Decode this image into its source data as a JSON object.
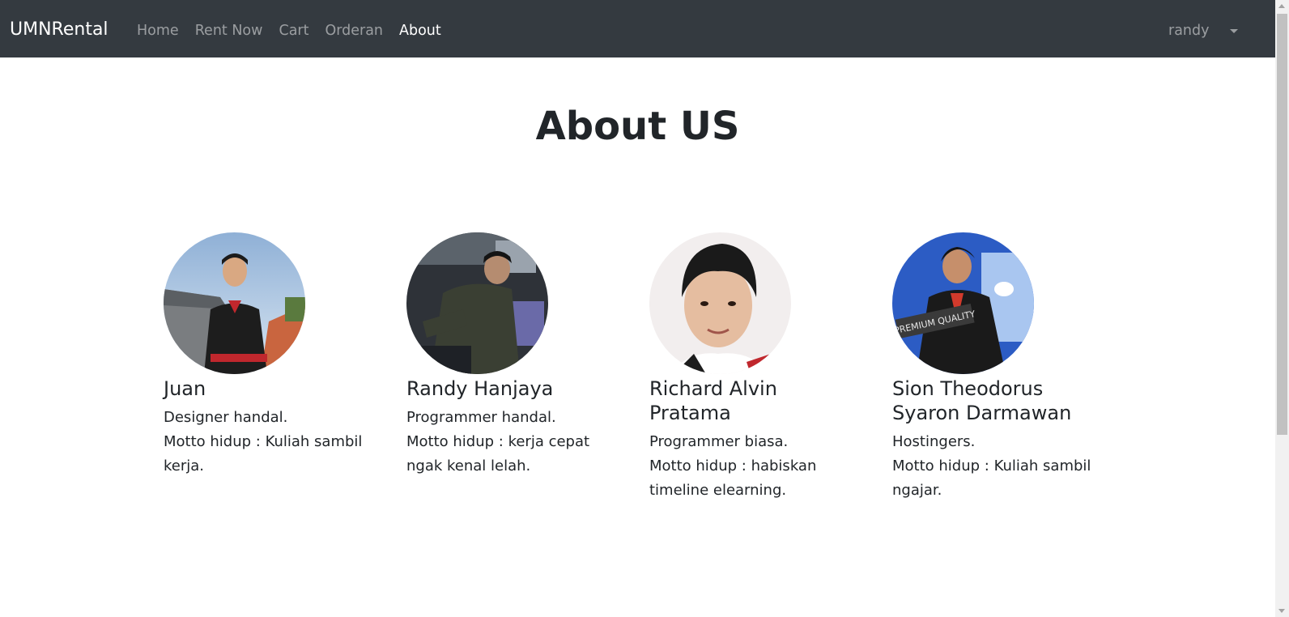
{
  "nav": {
    "brand": "UMNRental",
    "links": [
      "Home",
      "Rent Now",
      "Cart",
      "Orderan",
      "About"
    ],
    "active": "About",
    "user": "randy"
  },
  "page": {
    "title": "About US"
  },
  "members": [
    {
      "name": "Juan",
      "role": "Designer handal.",
      "motto": "Motto hidup : Kuliah sambil kerja."
    },
    {
      "name": "Randy Hanjaya",
      "role": "Programmer handal.",
      "motto": "Motto hidup : kerja cepat ngak kenal lelah."
    },
    {
      "name": "Richard Alvin Pratama",
      "role": "Programmer biasa.",
      "motto": "Motto hidup : habiskan timeline elearning."
    },
    {
      "name": "Sion Theodorus Syaron Darmawan",
      "role": "Hostingers.",
      "motto": "Motto hidup : Kuliah sambil ngajar."
    }
  ],
  "avatar_badge_text": "PREMIUM QUALITY"
}
